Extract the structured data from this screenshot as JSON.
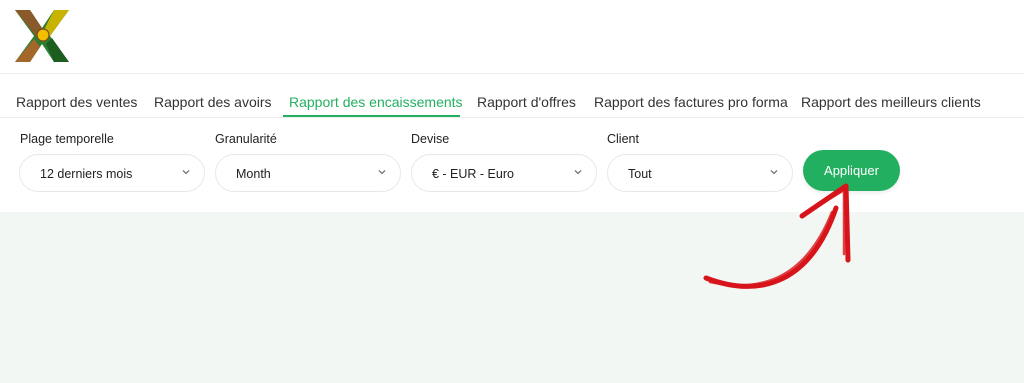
{
  "tabs": [
    {
      "label": "Rapport des ventes",
      "active": false
    },
    {
      "label": "Rapport des avoirs",
      "active": false
    },
    {
      "label": "Rapport des encaissements",
      "active": true
    },
    {
      "label": "Rapport d'offres",
      "active": false
    },
    {
      "label": "Rapport des factures pro forma",
      "active": false
    },
    {
      "label": "Rapport des meilleurs clients",
      "active": false
    }
  ],
  "filters": {
    "period": {
      "label": "Plage temporelle",
      "value": "12 derniers mois"
    },
    "granularity": {
      "label": "Granularité",
      "value": "Month"
    },
    "currency": {
      "label": "Devise",
      "value": "€ - EUR - Euro"
    },
    "client": {
      "label": "Client",
      "value": "Tout"
    }
  },
  "apply_label": "Appliquer",
  "colors": {
    "accent": "#22b060",
    "annotation_arrow": "#d8141b",
    "content_bg": "#f3f7f3"
  },
  "icons": {
    "logo": "brand-logo-x",
    "select_chevron": "chevron-down-icon",
    "annotation": "curved-arrow-icon"
  }
}
